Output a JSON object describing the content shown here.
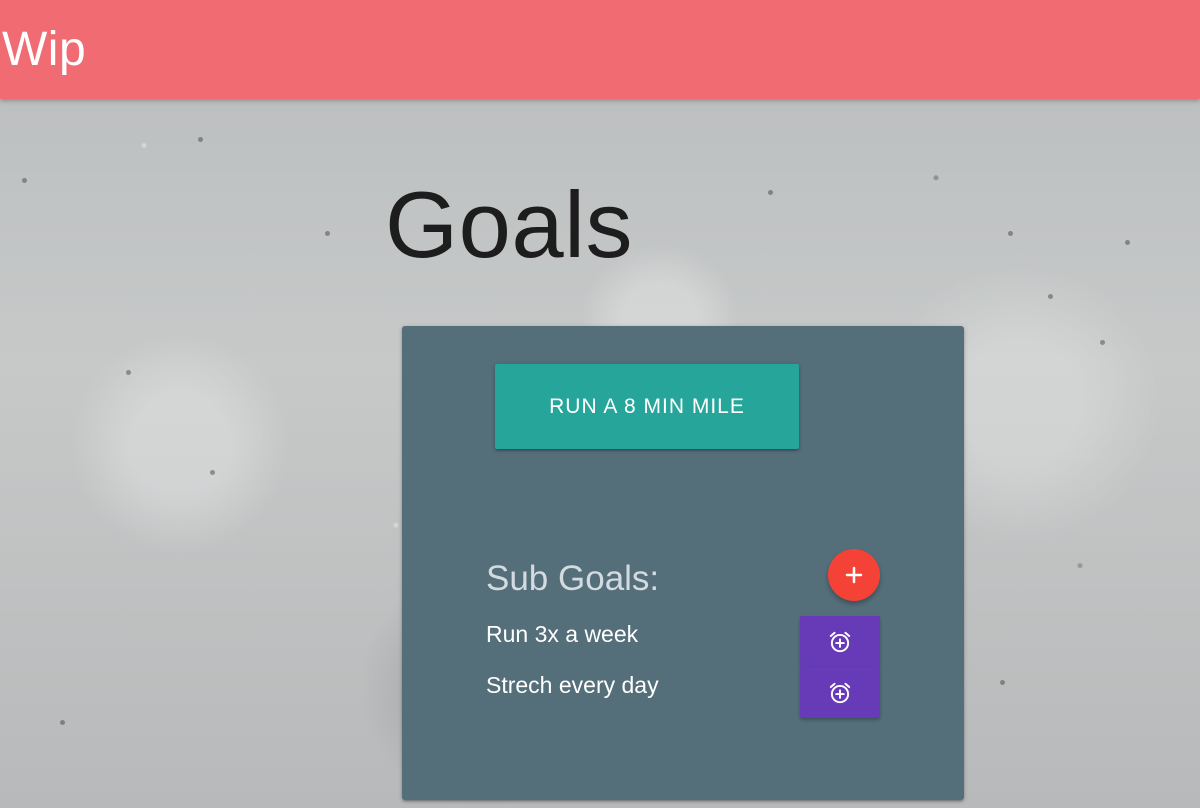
{
  "app_bar": {
    "title": "Wip",
    "color": "#f06b72"
  },
  "page": {
    "heading": "Goals"
  },
  "goal_card": {
    "background": "#546e7a",
    "goal_label": "RUN A 8 MIN MILE",
    "goal_button_color": "#26a69a",
    "sub_goals_title": "Sub Goals:",
    "add_icon": "plus-icon",
    "add_button_color": "#f44336",
    "sub_goals": [
      {
        "label": "Run 3x a week",
        "icon": "add-alarm-icon"
      },
      {
        "label": "Strech every day",
        "icon": "add-alarm-icon"
      }
    ],
    "alarm_button_color": "#673ab7"
  }
}
